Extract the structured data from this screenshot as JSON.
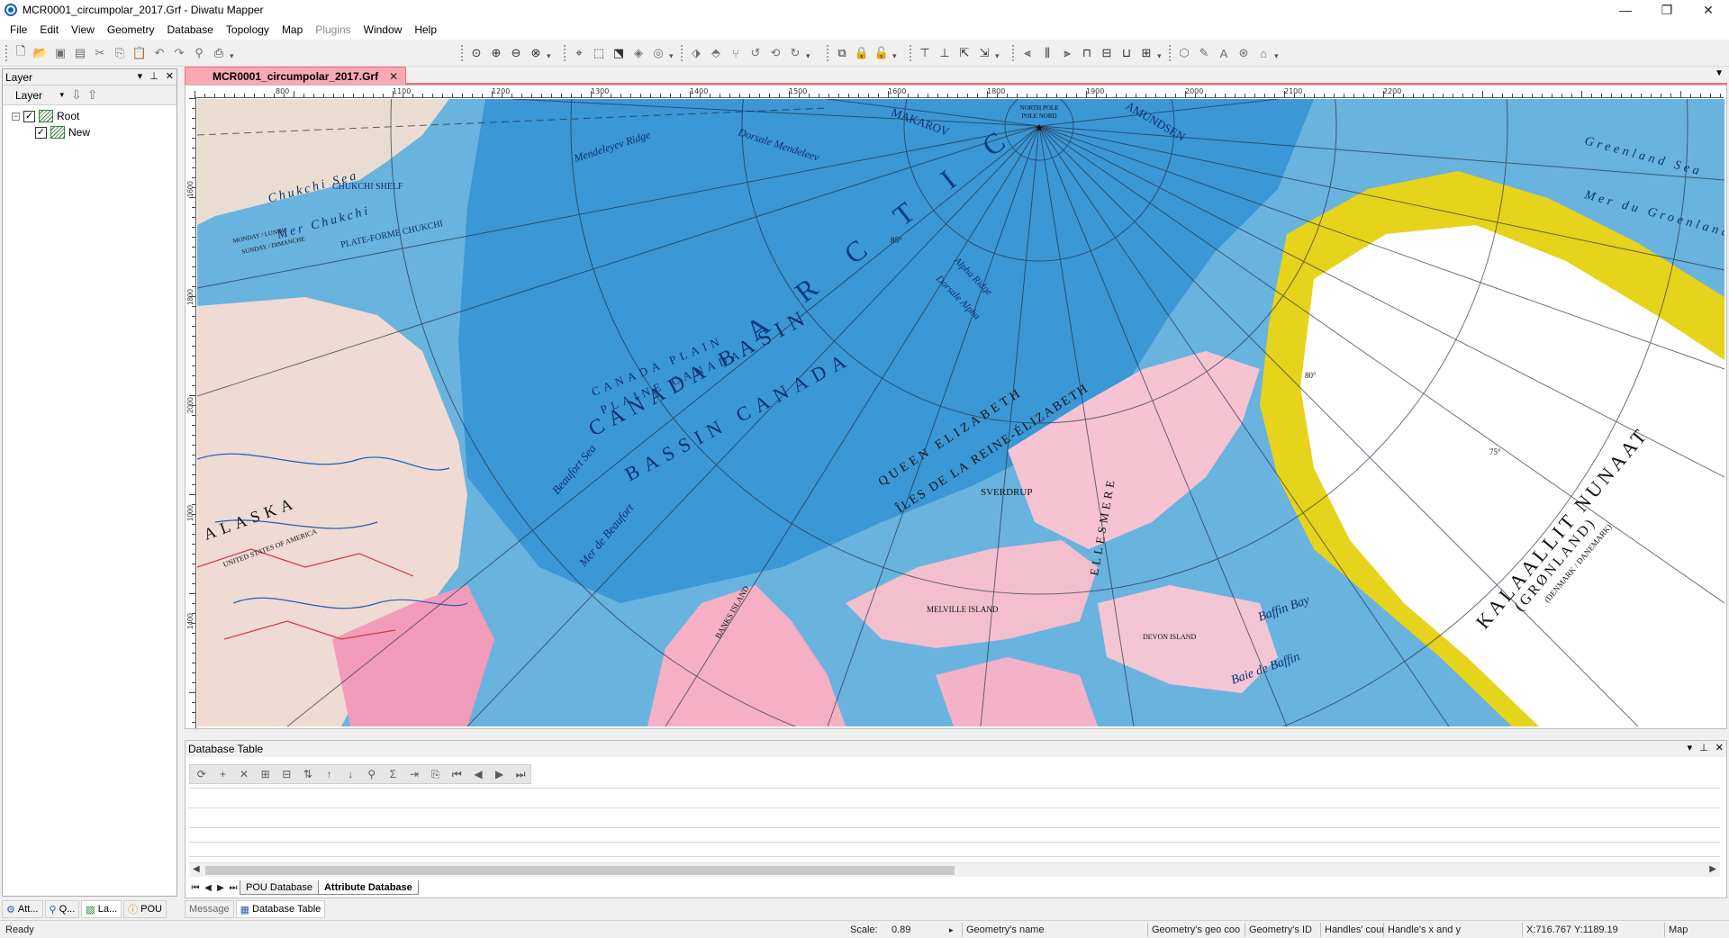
{
  "window": {
    "title": "MCR0001_circumpolar_2017.Grf - Diwatu Mapper",
    "controls": [
      "—",
      "❐",
      "✕"
    ]
  },
  "menu": {
    "items": [
      "File",
      "Edit",
      "View",
      "Geometry",
      "Database",
      "Topology",
      "Map",
      "Plugins",
      "Window",
      "Help"
    ],
    "disabled": [
      "Plugins"
    ]
  },
  "layer_panel": {
    "title": "Layer",
    "combo_value": "Layer",
    "tree": [
      {
        "label": "Root",
        "checked": true
      },
      {
        "label": "New",
        "checked": true
      }
    ]
  },
  "document": {
    "tab_label": "MCR0001_circumpolar_2017.Grf",
    "ruler_h_labels": [
      "800",
      "1100",
      "1200",
      "1300",
      "1400",
      "1500",
      "1600",
      "1800",
      "1900",
      "2000",
      "2100",
      "2200"
    ],
    "ruler_v_labels": [
      "1600",
      "1800",
      "2000",
      "1000",
      "1400"
    ]
  },
  "map_labels": {
    "arctic": "A R C T I C",
    "canada_basin": "CANADA BASIN",
    "bassin_canada": "BASSIN CANADA",
    "canada_plain": "CANADA PLAIN",
    "plaine_canada": "PLAINE CANADA",
    "beaufort_sea": "Beaufort Sea",
    "mer_beaufort": "Mer de Beaufort",
    "chukchi_sea": "Chukchi Sea",
    "mer_chukchi": "Mer Chukchi",
    "chukchi_shelf": "CHUKCHI SHELF",
    "plateforme_chukchi": "PLATE-FORME CHUKCHI",
    "mendeleyev_ridge": "Mendeleyev Ridge",
    "dorsale_mendeleev": "Dorsale Mendeleev",
    "north_pole": "NORTH POLE",
    "pole_nord": "POLE NORD",
    "makarov": "MAKAROV",
    "amundsen": "AMUNDSEN",
    "alpha_ridge": "Alpha Ridge",
    "dorsale_alpha": "Dorsale Alpha",
    "greenland_sea": "Greenland Sea",
    "mer_groenland": "Mer du Groenland",
    "kalaallit": "KALAALLIT NUNAAT",
    "gronland": "(GRØNLAND)",
    "denmark": "(DENMARK / DANEMARK)",
    "queen_elizabeth": "QUEEN ELIZABETH",
    "iles_elizabeth": "ÎLES DE LA REINE-ÉLIZABETH",
    "ellesmere": "ELLESMERE",
    "sverdrup": "SVERDRUP",
    "baffin_bay": "Baffin Bay",
    "baie_baffin": "Baie de Baffin",
    "alaska": "ALASKA",
    "usa": "UNITED STATES OF AMERICA",
    "devon": "DEVON ISLAND",
    "banks": "BANKS ISLAND",
    "melville": "MELVILLE ISLAND",
    "monday_lundi": "MONDAY / LUNDI",
    "sunday_dimanche": "SUNDAY / DIMANCHE",
    "lat_75": "75°",
    "lat_80": "80°",
    "lat_85": "85°"
  },
  "db_panel": {
    "title": "Database Table",
    "sheet_tabs": [
      "POU Database",
      "Attribute Database"
    ],
    "active_sheet": "Attribute Database"
  },
  "dock_tabs": {
    "left": [
      "Att...",
      "Q...",
      "La...",
      "POU"
    ],
    "right": [
      "Message",
      "Database Table"
    ]
  },
  "status": {
    "ready": "Ready",
    "scale_label": "Scale: 1:",
    "scale_value": "0.89",
    "geometry_name": "Geometry's name",
    "geometry_geo": "Geometry's geo coo",
    "geometry_id": "Geometry's ID",
    "handles_count": "Handles' coun",
    "handles_xy": "Handle's x and y",
    "coords": "X:716.767 Y:1189.19",
    "mode": "Map"
  },
  "colors": {
    "ocean_deep": "#2e86d1",
    "ocean_shelf": "#8ecbe8",
    "land_pink": "#f5b8c8",
    "land_tan": "#efd6cf",
    "greenland_ice": "#ffffff",
    "greenland_edge": "#e8d91a",
    "tab_pink": "#f9a8b4",
    "tab_border": "#f26d7d"
  }
}
